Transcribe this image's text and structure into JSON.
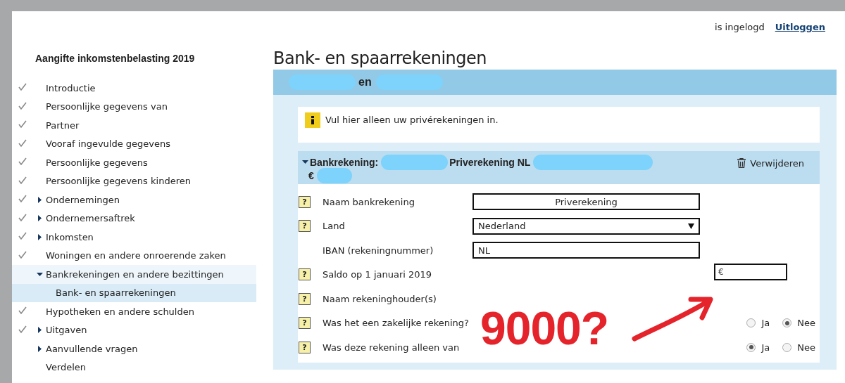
{
  "user_bar": {
    "status": "is ingelogd",
    "logout": "Uitloggen"
  },
  "sidebar": {
    "title": "Aangifte inkomstenbelasting 2019",
    "items": [
      {
        "label": "Introductie",
        "checked": true,
        "expanded": false,
        "selected": false
      },
      {
        "label": "Persoonlijke gegevens van",
        "checked": true,
        "expanded": false,
        "selected": false
      },
      {
        "label": "Partner",
        "checked": true,
        "expanded": false,
        "selected": false
      },
      {
        "label": "Vooraf ingevulde gegevens",
        "checked": true,
        "expanded": false,
        "selected": false
      },
      {
        "label": "Persoonlijke gegevens",
        "checked": true,
        "expanded": false,
        "selected": false
      },
      {
        "label": "Persoonlijke gegevens kinderen",
        "checked": true,
        "expanded": false,
        "selected": false
      },
      {
        "label": "Ondernemingen",
        "checked": true,
        "kind": "group",
        "expanded": false,
        "selected": false
      },
      {
        "label": "Ondernemersaftrek",
        "checked": true,
        "kind": "group",
        "expanded": false,
        "selected": false
      },
      {
        "label": "Inkomsten",
        "checked": true,
        "kind": "group",
        "expanded": false,
        "selected": false
      },
      {
        "label": "Woningen en andere onroerende zaken",
        "checked": true,
        "expanded": false,
        "selected": false
      },
      {
        "label": "Bankrekeningen en andere bezittingen",
        "checked": false,
        "kind": "group",
        "expanded": true,
        "selected": false,
        "children": [
          {
            "label": "Bank- en spaarrekeningen",
            "checked": false,
            "expanded": false,
            "selected": true
          }
        ]
      },
      {
        "label": "Hypotheken en andere schulden",
        "checked": true,
        "expanded": false,
        "selected": false
      },
      {
        "label": "Uitgaven",
        "checked": true,
        "kind": "group",
        "expanded": false,
        "selected": false
      },
      {
        "label": "Aanvullende vragen",
        "checked": false,
        "kind": "group",
        "expanded": false,
        "selected": false
      },
      {
        "label": "Verdelen",
        "checked": false,
        "expanded": false,
        "selected": false
      }
    ]
  },
  "page_title": "Bank- en spaarrekeningen",
  "section_header": [
    {
      "kind": "redacted"
    },
    {
      "kind": "text",
      "text": "en"
    },
    {
      "kind": "redacted"
    }
  ],
  "info": "Vul hier alleen uw privérekeningen in.",
  "account": {
    "expanded": true,
    "line1": [
      {
        "kind": "text",
        "text": "Bankrekening:"
      },
      {
        "kind": "redacted"
      },
      {
        "kind": "text",
        "text": "Priverekening NL"
      },
      {
        "kind": "redacted",
        "wide": true
      }
    ],
    "line2": [
      {
        "kind": "text",
        "text": "€"
      },
      {
        "kind": "redacted",
        "small": true
      }
    ],
    "delete": "Verwijderen",
    "rows": [
      {
        "kind": "text",
        "help": "?",
        "label": "Naam bankrekening",
        "value": "Priverekening",
        "centered": true
      },
      {
        "kind": "select",
        "help": "?",
        "label": "Land",
        "value": "Nederland"
      },
      {
        "kind": "text",
        "label": "IBAN (rekeningnummer)",
        "value": "NL",
        "centered": false
      },
      {
        "kind": "money",
        "help": "?",
        "label": "Saldo op 1 januari 2019",
        "prefix": "€"
      },
      {
        "kind": "none",
        "help": "?",
        "label": "Naam rekeninghouder(s)"
      },
      {
        "kind": "radio",
        "help": "?",
        "label": "Was het een zakelijke rekening?",
        "options": [
          {
            "label": "Ja",
            "selected": false
          },
          {
            "label": "Nee",
            "selected": true
          }
        ]
      },
      {
        "kind": "radio",
        "help": "?",
        "label": "Was deze rekening alleen van",
        "options": [
          {
            "label": "Ja",
            "selected": true
          },
          {
            "label": "Nee",
            "selected": false
          }
        ]
      }
    ]
  },
  "annotation": {
    "text": "9000?"
  }
}
